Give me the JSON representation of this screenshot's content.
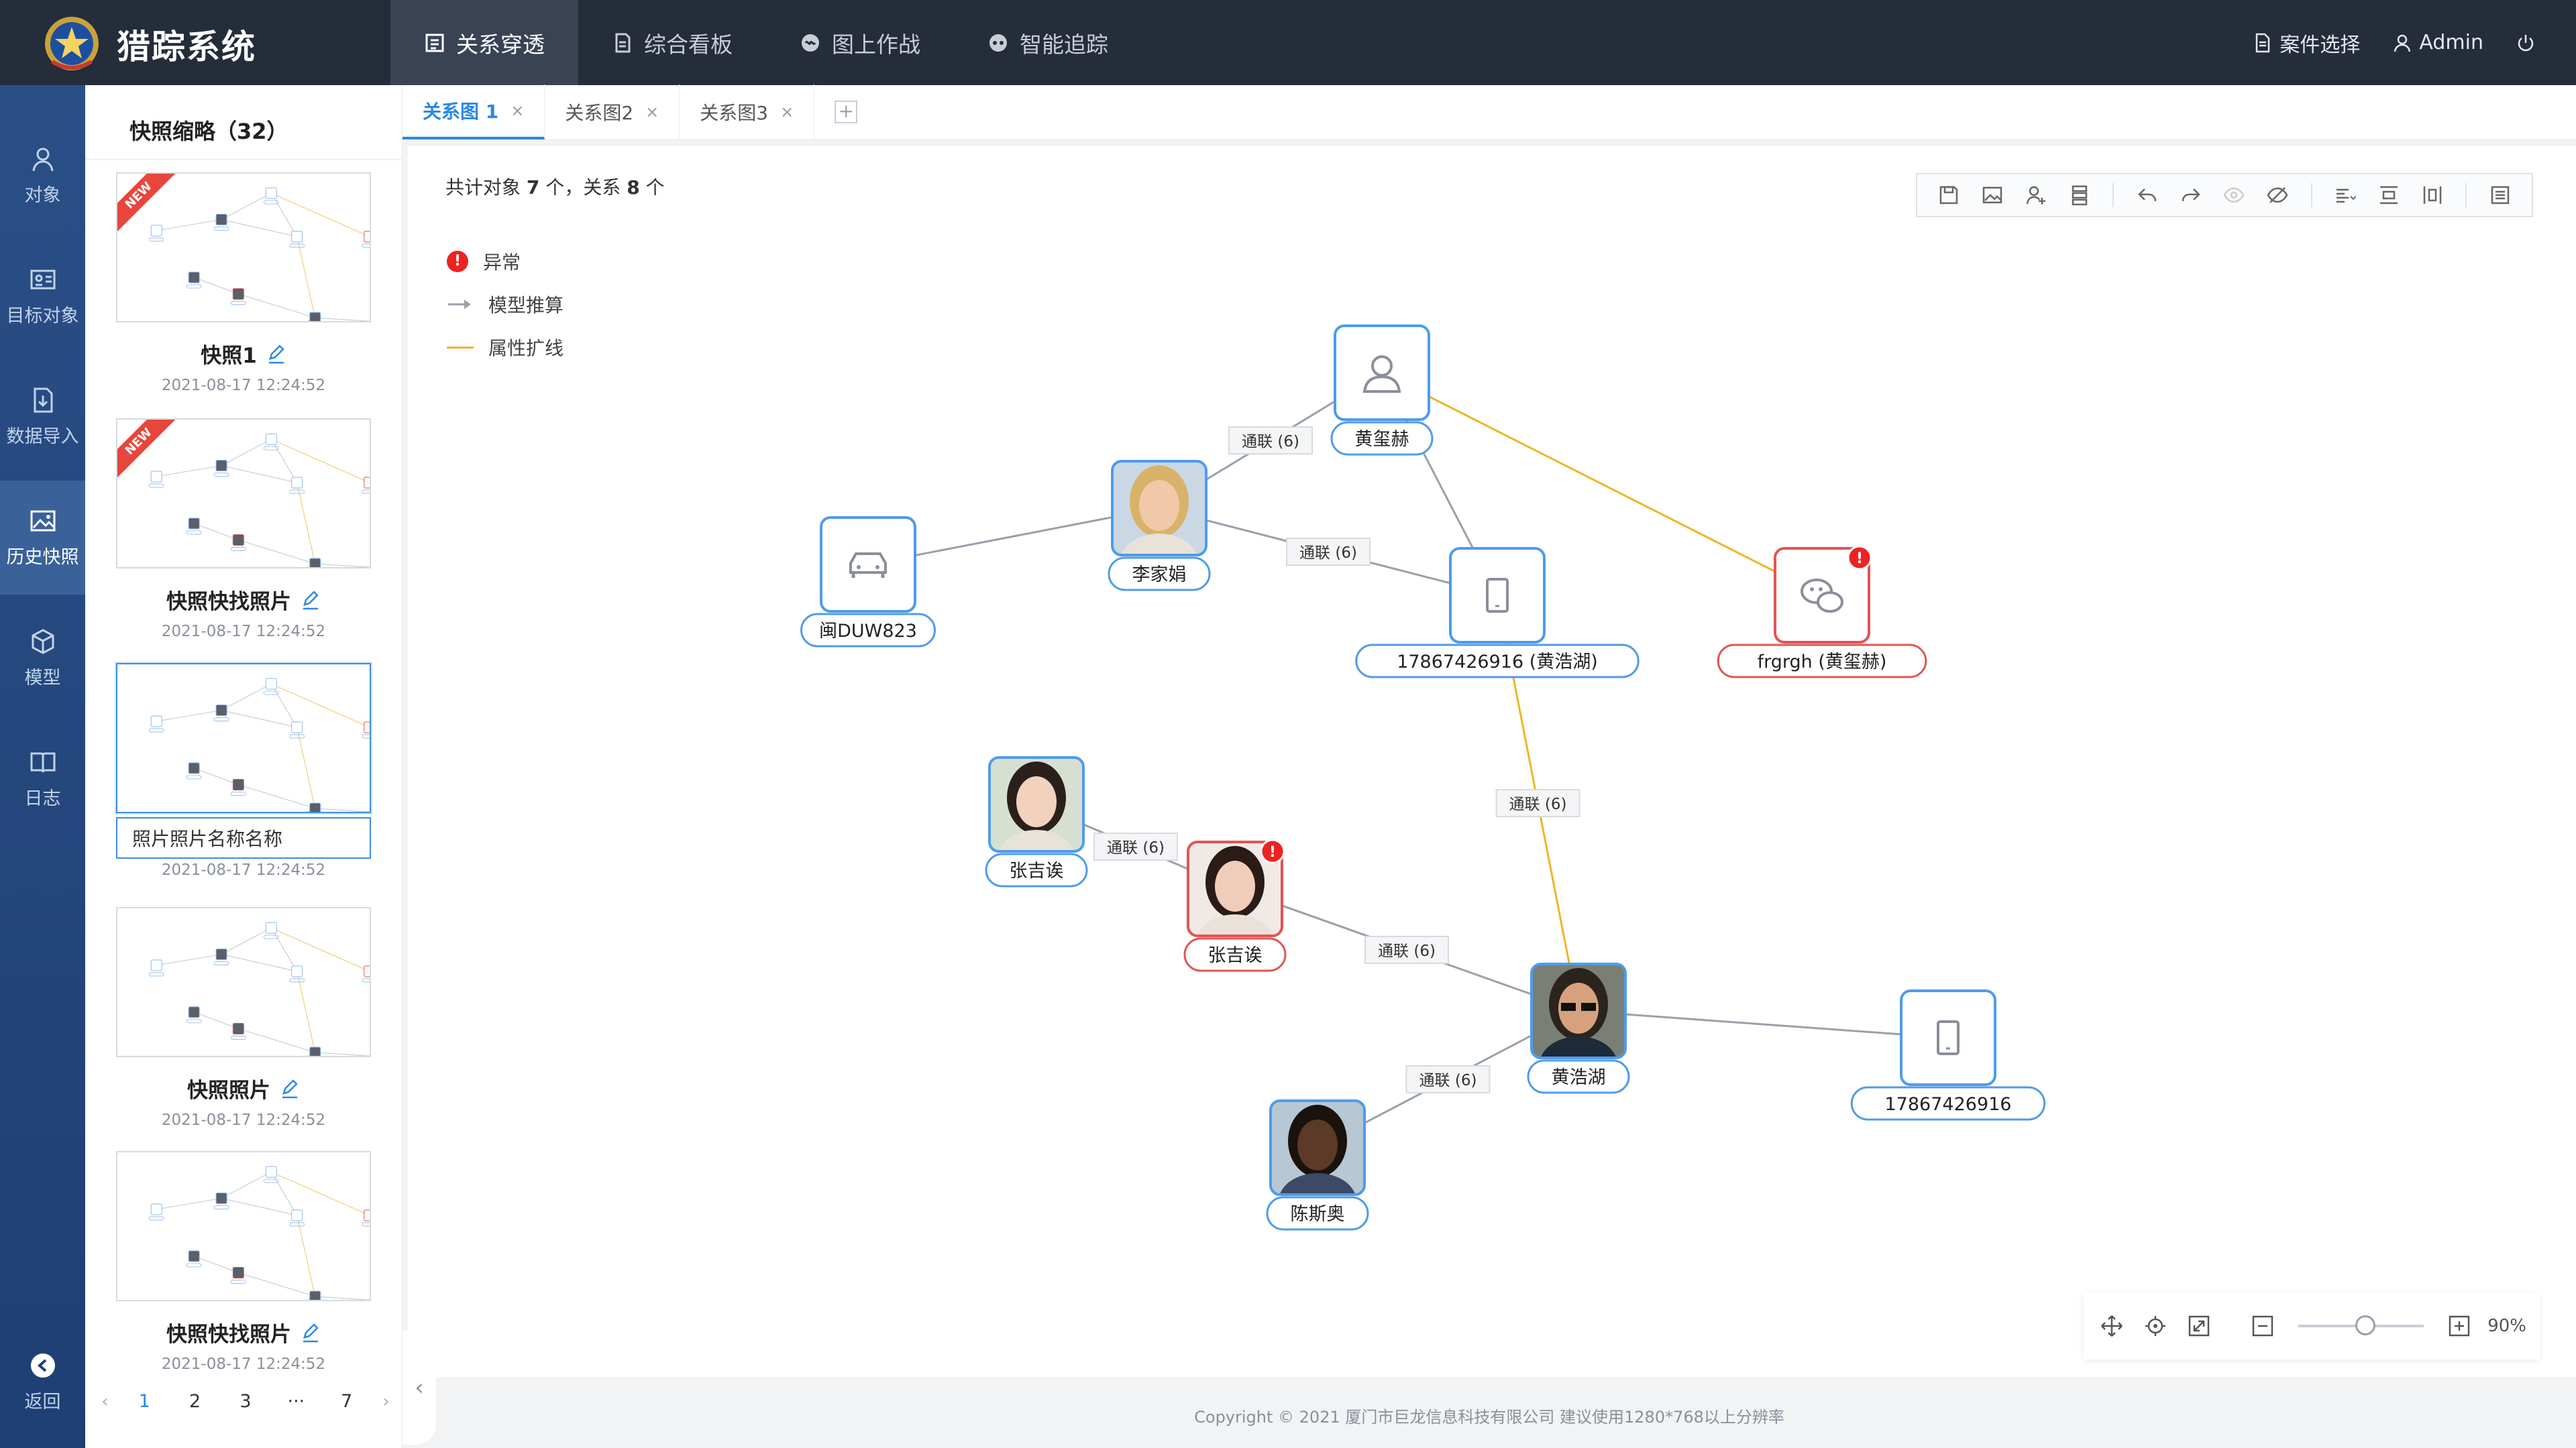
{
  "app": {
    "title": "猎踪系统",
    "logo_icon": "police-emblem-icon"
  },
  "nav": [
    {
      "label": "关系穿透",
      "icon": "relation-icon",
      "active": true
    },
    {
      "label": "综合看板",
      "icon": "dashboard-icon",
      "active": false
    },
    {
      "label": "图上作战",
      "icon": "map-battle-icon",
      "active": false
    },
    {
      "label": "智能追踪",
      "icon": "tracking-icon",
      "active": false
    }
  ],
  "topright": {
    "case_select": "案件选择",
    "user": "Admin"
  },
  "rail": [
    {
      "label": "对象",
      "icon": "user-icon"
    },
    {
      "label": "目标对象",
      "icon": "id-card-icon"
    },
    {
      "label": "数据导入",
      "icon": "import-icon"
    },
    {
      "label": "历史快照",
      "icon": "image-icon",
      "active": true
    },
    {
      "label": "模型",
      "icon": "cube-icon"
    },
    {
      "label": "日志",
      "icon": "book-icon"
    },
    {
      "label": "返回",
      "icon": "back-icon"
    }
  ],
  "snapshots": {
    "title": "快照缩略（32）",
    "items": [
      {
        "name": "快照1",
        "date": "2021-08-17  12:24:52",
        "is_new": true,
        "badge": "NEW"
      },
      {
        "name": "快照快找照片",
        "date": "2021-08-17  12:24:52",
        "is_new": true,
        "badge": "NEW"
      },
      {
        "name": "照片照片名称名称",
        "date": "2021-08-17  12:24:52",
        "editing": true
      },
      {
        "name": "快照照片",
        "date": "2021-08-17  12:24:52"
      },
      {
        "name": "快照快找照片",
        "date": "2021-08-17  12:24:52"
      }
    ],
    "pager": {
      "prev": "‹",
      "pages": [
        "1",
        "2",
        "3",
        "···",
        "7"
      ],
      "current": "1",
      "next": "›"
    },
    "collapse": "‹"
  },
  "tabs": [
    {
      "label": "关系图 1",
      "active": true,
      "close": "×"
    },
    {
      "label": "关系图2",
      "close": "×"
    },
    {
      "label": "关系图3",
      "close": "×"
    }
  ],
  "tab_add": "+",
  "summary": {
    "prefix": "共计对象",
    "objects": "7",
    "mid": "个，关系",
    "relations": "8",
    "suffix": "个"
  },
  "legend": [
    {
      "label": "异常",
      "mark": "!"
    },
    {
      "label": "模型推算"
    },
    {
      "label": "属性扩线"
    }
  ],
  "graph": {
    "nodes": [
      {
        "id": "hxh",
        "label": "黄玺赫",
        "kind": "person-outline-icon"
      },
      {
        "id": "ljj",
        "label": "李家娟",
        "kind": "photo",
        "photo": "woman-blonde"
      },
      {
        "id": "car",
        "label": "闽DUW823",
        "kind": "car-icon"
      },
      {
        "id": "ph1",
        "label": "17867426916 (黄浩湖)",
        "kind": "phone-icon"
      },
      {
        "id": "wx",
        "label": "frgrgh (黄玺赫)",
        "kind": "wechat-icon",
        "abnormal": true
      },
      {
        "id": "zjy1",
        "label": "张吉诶",
        "kind": "photo",
        "photo": "woman-asian"
      },
      {
        "id": "zjy2",
        "label": "张吉诶",
        "kind": "photo",
        "photo": "woman-asian-2",
        "abnormal": true
      },
      {
        "id": "hhh",
        "label": "黄浩湖",
        "kind": "photo",
        "photo": "man-sunglasses"
      },
      {
        "id": "ph2",
        "label": "17867426916",
        "kind": "phone-icon"
      },
      {
        "id": "csa",
        "label": "陈斯奥",
        "kind": "photo",
        "photo": "man-beard"
      }
    ],
    "edges": [
      {
        "from": "ljj",
        "to": "hxh",
        "label": "通联 (6)",
        "type": "gray"
      },
      {
        "from": "car",
        "to": "ljj",
        "type": "gray"
      },
      {
        "from": "ljj",
        "to": "ph1",
        "label": "通联 (6)",
        "type": "gray"
      },
      {
        "from": "hxh",
        "to": "ph1",
        "type": "gray"
      },
      {
        "from": "hxh",
        "to": "wx",
        "type": "orange"
      },
      {
        "from": "ph1",
        "to": "hhh",
        "label": "通联 (6)",
        "type": "orange"
      },
      {
        "from": "zjy1",
        "to": "zjy2",
        "label": "通联 (6)",
        "type": "gray"
      },
      {
        "from": "zjy2",
        "to": "hhh",
        "label": "通联 (6)",
        "type": "gray"
      },
      {
        "from": "hhh",
        "to": "ph2",
        "type": "gray"
      },
      {
        "from": "csa",
        "to": "hhh",
        "label": "通联 (6)",
        "type": "gray"
      }
    ],
    "abnormal_mark": "!"
  },
  "toolbar": {
    "icons": [
      "save-icon",
      "export-image-icon",
      "add-user-icon",
      "layers-icon",
      "undo-icon",
      "redo-icon",
      "show-icon",
      "hide-icon",
      "align-icon",
      "distribute-vertical-icon",
      "distribute-horizontal-icon",
      "list-icon"
    ]
  },
  "zoom": {
    "value": "90%",
    "level": 0.9
  },
  "footer": "Copyright © 2021  厦门市巨龙信息科技有限公司  建议使用1280*768以上分辨率",
  "colors": {
    "accent": "#2a88e6",
    "abnormal": "#e22",
    "orange_edge": "#f0b429",
    "gray_edge": "#9aa0aa",
    "topbar": "#252c3a",
    "rail": "#1e3f73"
  }
}
